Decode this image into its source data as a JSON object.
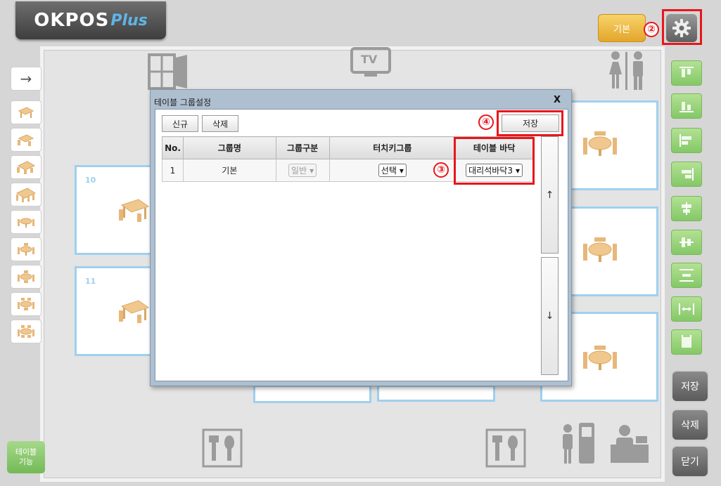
{
  "app": {
    "logo_text": "OKPOS",
    "logo_plus": "Plus"
  },
  "header": {
    "basic_label": "기본",
    "marker_2": "②"
  },
  "floor": {
    "tv_label": "TV",
    "tables": [
      {
        "number": "10"
      },
      {
        "number": "11"
      }
    ]
  },
  "left_toolbar": {
    "arrow": "→",
    "table_function_line1": "테이블",
    "table_function_line2": "기능"
  },
  "right_toolbar": {
    "save": "저장",
    "delete": "삭제",
    "close": "닫기"
  },
  "dialog": {
    "title": "테이블 그룹설정",
    "close": "X",
    "new_button": "신규",
    "delete_button": "삭제",
    "save_button": "저장",
    "marker_3": "③",
    "marker_4": "④",
    "scroll_up": "↑",
    "scroll_down": "↓",
    "columns": {
      "no": "No.",
      "group_name": "그룹명",
      "group_type": "그룹구분",
      "touchkey_group": "터치키그룹",
      "table_floor": "테이블 바닥"
    },
    "rows": [
      {
        "no": "1",
        "group_name": "기본",
        "group_type": "일반",
        "touchkey_group": "선택",
        "table_floor": "대리석바닥3"
      }
    ]
  },
  "colors": {
    "accent_red": "#e8161b",
    "table_border": "#9fd0ee",
    "green_button": "#84c867",
    "yellow_button": "#e3a62b"
  }
}
